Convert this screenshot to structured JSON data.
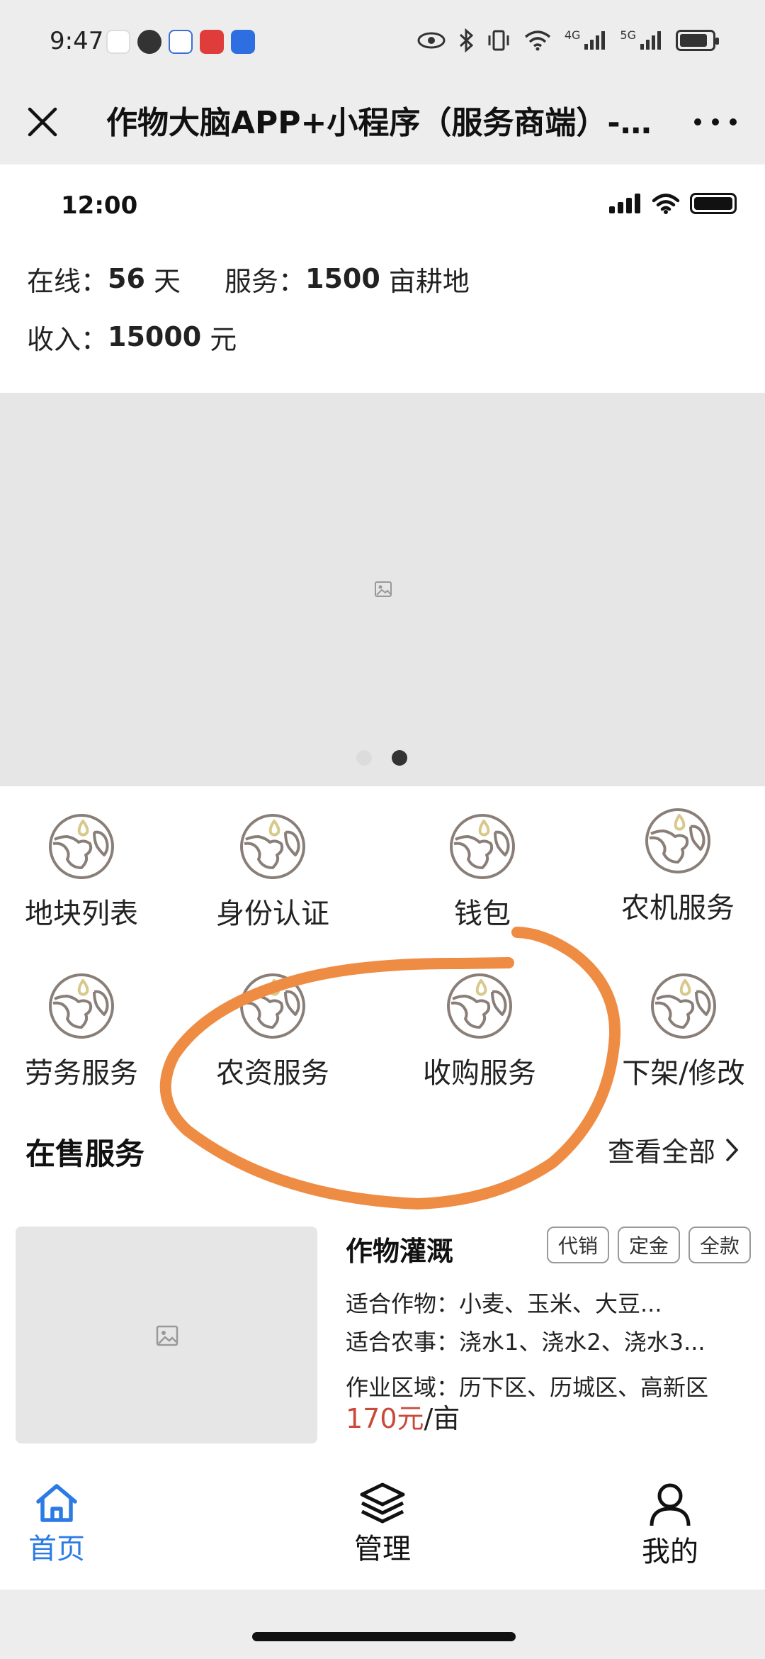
{
  "system_bar": {
    "time": "9:47",
    "network_4g": "4G",
    "network_5g": "5G"
  },
  "mini_program": {
    "title": "作物大脑APP+小程序（服务商端）-..."
  },
  "ios_bar": {
    "time": "12:00"
  },
  "stats": {
    "online_label": "在线：",
    "online_value": "56",
    "online_unit": " 天",
    "service_label": "服务：",
    "service_value": "1500",
    "service_unit": " 亩耕地",
    "income_label": "收入：",
    "income_value": "15000",
    "income_unit": " 元"
  },
  "banner": {
    "dot_count": 2,
    "active_dot": 2
  },
  "grid": {
    "items": [
      {
        "label": "地块列表",
        "icon": "globe-icon"
      },
      {
        "label": "身份认证",
        "icon": "globe-icon"
      },
      {
        "label": "钱包",
        "icon": "globe-icon"
      },
      {
        "label": "农机服务",
        "icon": "globe-icon"
      },
      {
        "label": "劳务服务",
        "icon": "globe-icon"
      },
      {
        "label": "农资服务",
        "icon": "globe-icon"
      },
      {
        "label": "收购服务",
        "icon": "globe-icon"
      },
      {
        "label": "下架/修改",
        "icon": "globe-icon"
      }
    ]
  },
  "section": {
    "title": "在售服务",
    "view_all": "查看全部"
  },
  "card": {
    "title": "作物灌溉",
    "tags": [
      "代销",
      "定金",
      "全款"
    ],
    "crops": "适合作物：小麦、玉米、大豆...",
    "tasks": "适合农事：浇水1、浇水2、浇水3...",
    "area": "作业区域：历下区、历城区、高新区",
    "price_amount": "170元",
    "price_unit": "/亩"
  },
  "tabs": [
    {
      "label": "首页",
      "icon": "home-icon",
      "active": true
    },
    {
      "label": "管理",
      "icon": "layers-icon",
      "active": false
    },
    {
      "label": "我的",
      "icon": "user-icon",
      "active": false
    }
  ],
  "colors": {
    "accent": "#2c7be5",
    "price": "#c94a3a",
    "annotation": "#ef8c44",
    "icon_stroke": "#8a7f78",
    "icon_drop": "#d8c98a"
  }
}
